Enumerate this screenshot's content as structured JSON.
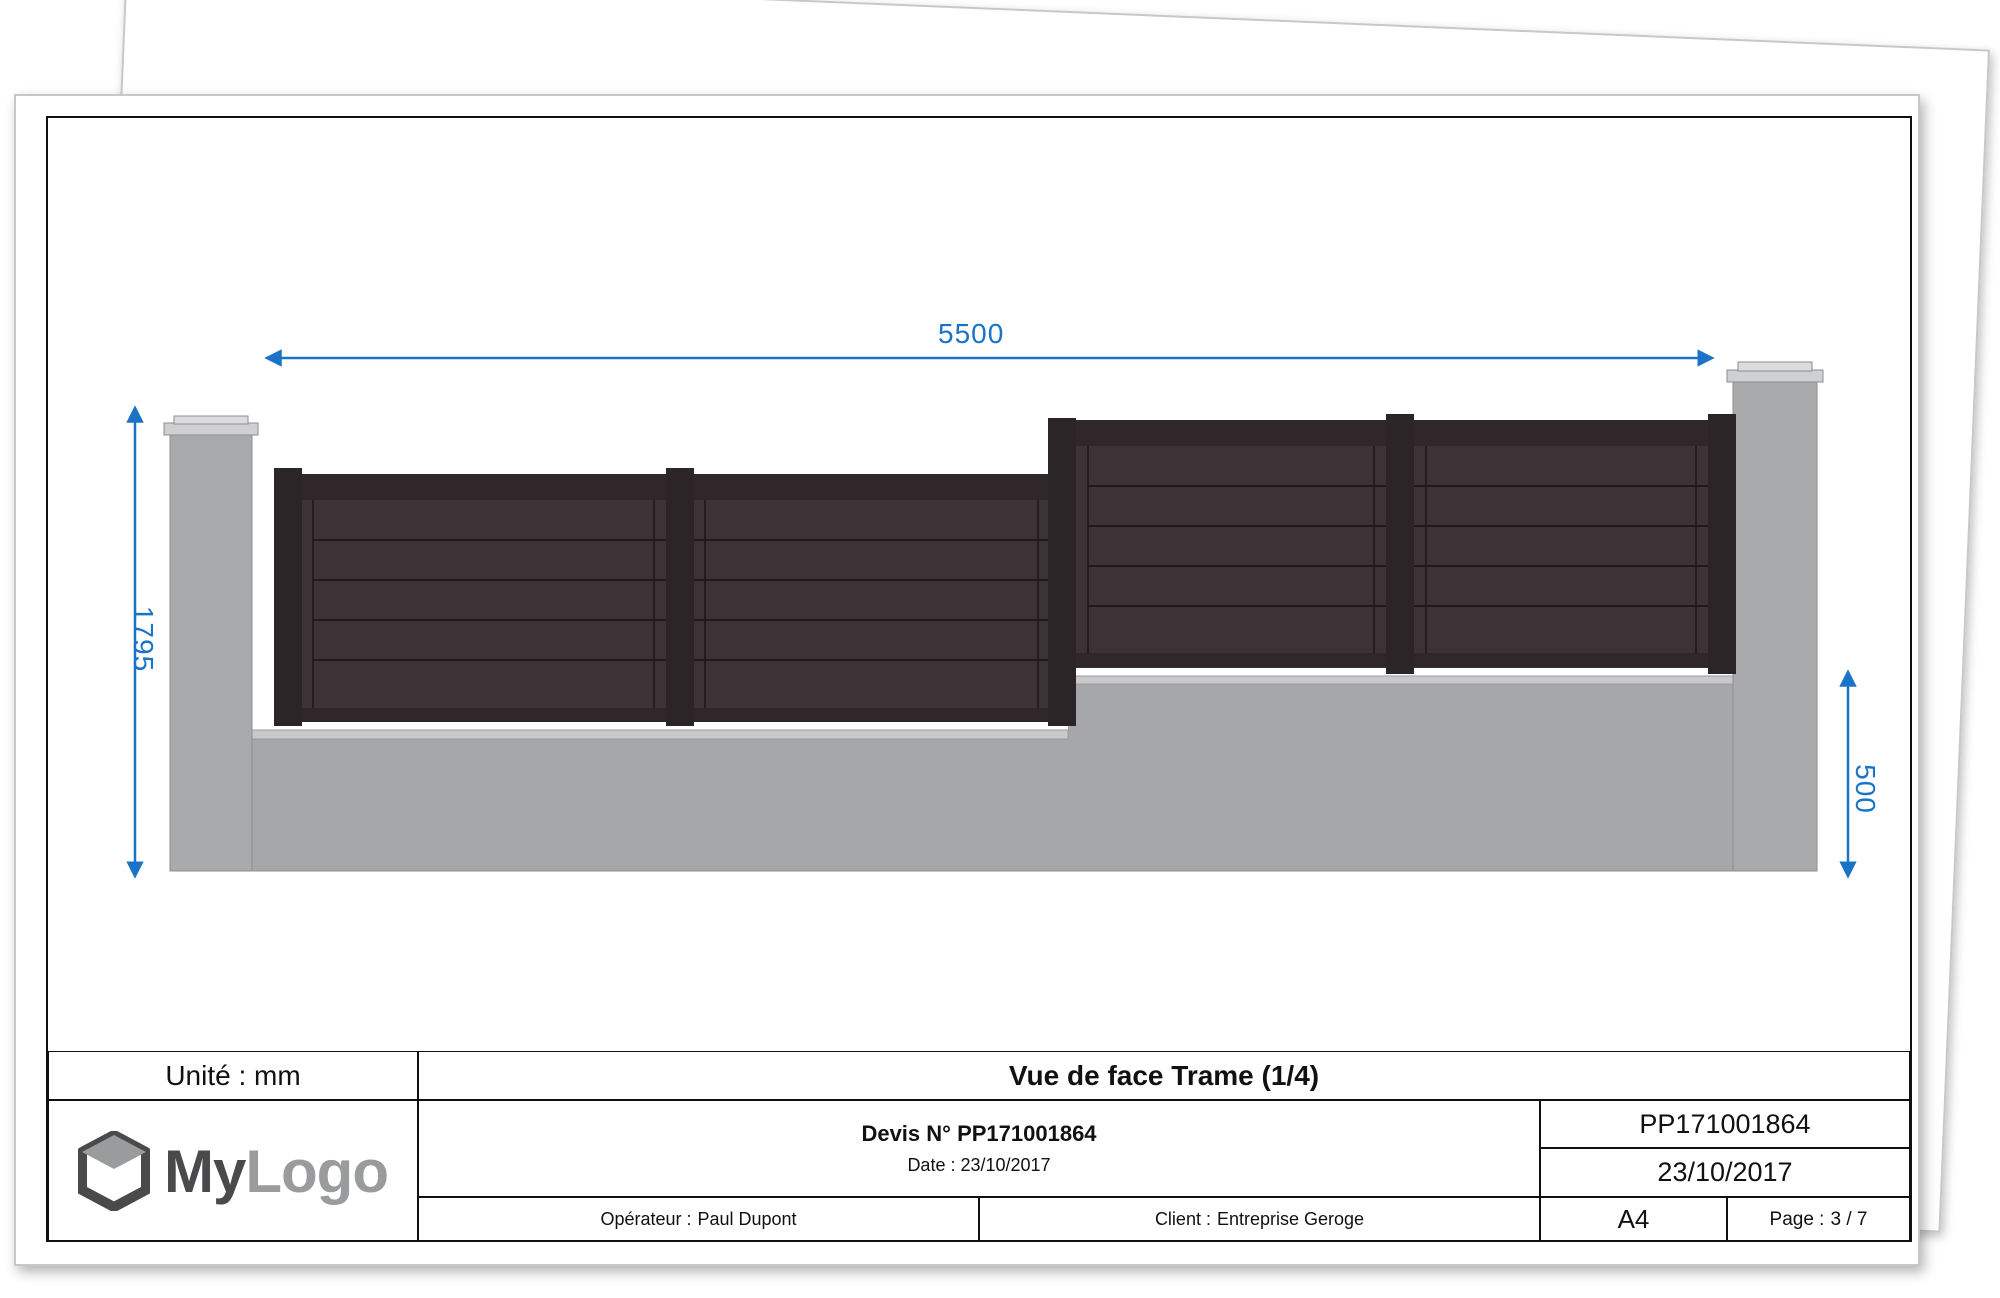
{
  "drawing": {
    "dimension_width": "5500",
    "dimension_height_total": "1795",
    "dimension_height_wall": "500",
    "colors": {
      "dimension": "#1a73c7",
      "fence_panel": "#3b3335",
      "fence_post": "#2c2527",
      "wall": "#a6a7a9",
      "pillar": "#a9aaac"
    }
  },
  "title_block": {
    "unit_label": "Unité : mm",
    "view_title": "Vue de face Trame (1/4)",
    "logo": {
      "icon": "cube-logo-icon",
      "text_my": "My",
      "text_logo": "Logo"
    },
    "devis_number": "Devis N° PP171001864",
    "devis_date": "Date : 23/10/2017",
    "reference": "PP171001864",
    "reference_date": "23/10/2017",
    "operator_label": "Opérateur :",
    "operator_name": "Paul Dupont",
    "client_label": "Client :",
    "client_name": "Entreprise Geroge",
    "format": "A4",
    "page_label": "Page :",
    "page_value": "3 / 7"
  }
}
